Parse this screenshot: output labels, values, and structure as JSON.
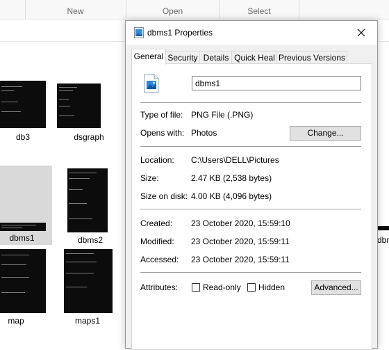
{
  "explorer": {
    "ribbon": {
      "groups": [
        "New",
        "Open",
        "Select"
      ]
    },
    "files": [
      "db3",
      "dsgraph",
      "dbms1",
      "dbms2",
      "map",
      "maps1",
      "dbm"
    ]
  },
  "dialog": {
    "title": "dbms1 Properties",
    "tabs": [
      "General",
      "Security",
      "Details",
      "Quick Heal",
      "Previous Versions"
    ],
    "file_name": "dbms1",
    "type_of_file": {
      "label": "Type of file:",
      "value": "PNG File (.PNG)"
    },
    "opens_with": {
      "label": "Opens with:",
      "value": "Photos",
      "button": "Change..."
    },
    "location": {
      "label": "Location:",
      "value": "C:\\Users\\DELL\\Pictures"
    },
    "size": {
      "label": "Size:",
      "value": "2.47 KB (2,538 bytes)"
    },
    "size_on_disk": {
      "label": "Size on disk:",
      "value": "4.00 KB (4,096 bytes)"
    },
    "created": {
      "label": "Created:",
      "value": "23 October 2020, 15:59:10"
    },
    "modified": {
      "label": "Modified:",
      "value": "23 October 2020, 15:59:11"
    },
    "accessed": {
      "label": "Accessed:",
      "value": "23 October 2020, 15:59:11"
    },
    "attributes": {
      "label": "Attributes:",
      "read_only": "Read-only",
      "hidden": "Hidden",
      "advanced_button": "Advanced..."
    }
  }
}
